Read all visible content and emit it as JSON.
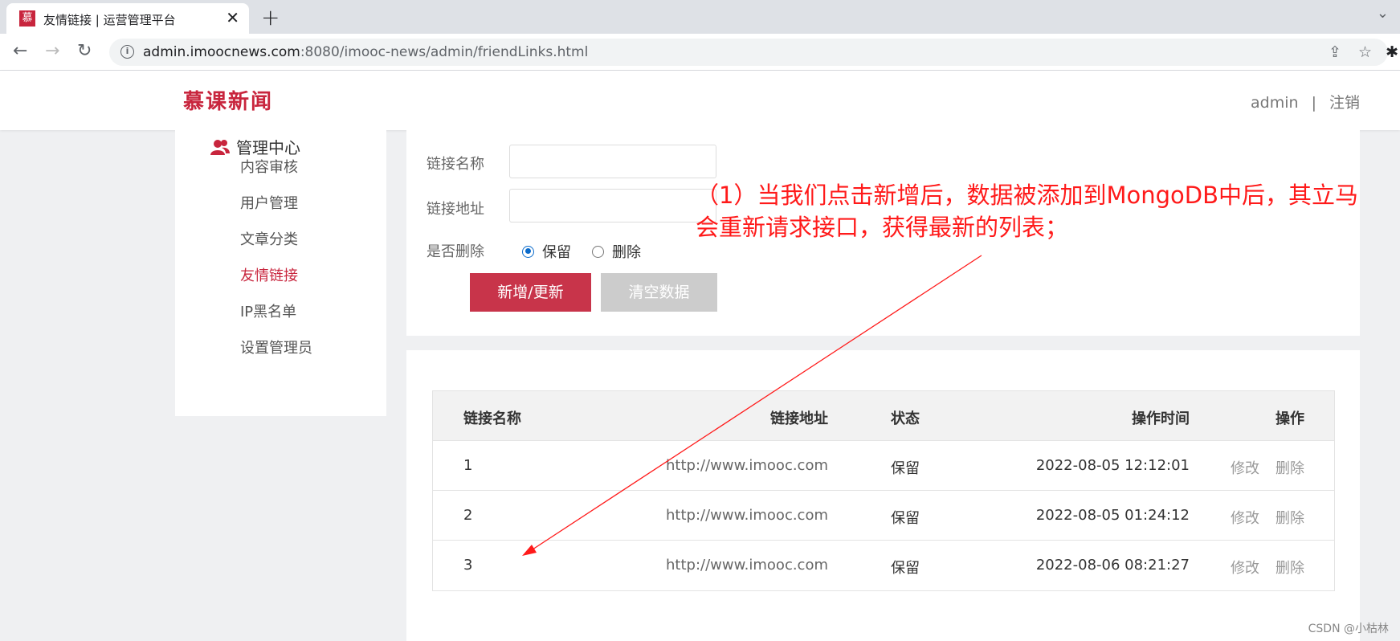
{
  "browser": {
    "tab_title": "友情链接 | 运营管理平台",
    "tab_favicon": "慕",
    "new_tab": "+",
    "close": "✕",
    "url_host": "admin.imoocnews.com",
    "url_rest": ":8080/imooc-news/admin/friendLinks.html"
  },
  "header": {
    "logo": "慕课新闻",
    "user": "admin",
    "separator": "|",
    "logout": "注销"
  },
  "sidebar": {
    "title": "管理中心",
    "items": [
      {
        "label": "内容审核",
        "active": false
      },
      {
        "label": "用户管理",
        "active": false
      },
      {
        "label": "文章分类",
        "active": false
      },
      {
        "label": "友情链接",
        "active": true
      },
      {
        "label": "IP黑名单",
        "active": false
      },
      {
        "label": "设置管理员",
        "active": false
      }
    ]
  },
  "form": {
    "name_label": "链接名称",
    "name_value": "",
    "url_label": "链接地址",
    "url_value": "",
    "delete_label": "是否删除",
    "radio_keep": "保留",
    "radio_delete": "删除",
    "selected": "保留",
    "submit_button": "新增/更新",
    "clear_button": "清空数据"
  },
  "table": {
    "headers": [
      "链接名称",
      "链接地址",
      "状态",
      "操作时间",
      "操作"
    ],
    "rows": [
      {
        "name": "1",
        "url": "http://www.imooc.com",
        "status": "保留",
        "time": "2022-08-05 12:12:01"
      },
      {
        "name": "2",
        "url": "http://www.imooc.com",
        "status": "保留",
        "time": "2022-08-05 01:24:12"
      },
      {
        "name": "3",
        "url": "http://www.imooc.com",
        "status": "保留",
        "time": "2022-08-06 08:21:27"
      }
    ],
    "op_edit": "修改",
    "op_delete": "删除"
  },
  "annotation": {
    "line1": "（1）当我们点击新增后，数据被添加到MongoDB中后，其立马",
    "line2": "会重新请求接口，获得最新的列表；"
  },
  "watermark": "CSDN @小枯林",
  "colors": {
    "brand": "#c8253d",
    "annotation": "#ff1a1a",
    "radio": "#0b6bcb"
  }
}
